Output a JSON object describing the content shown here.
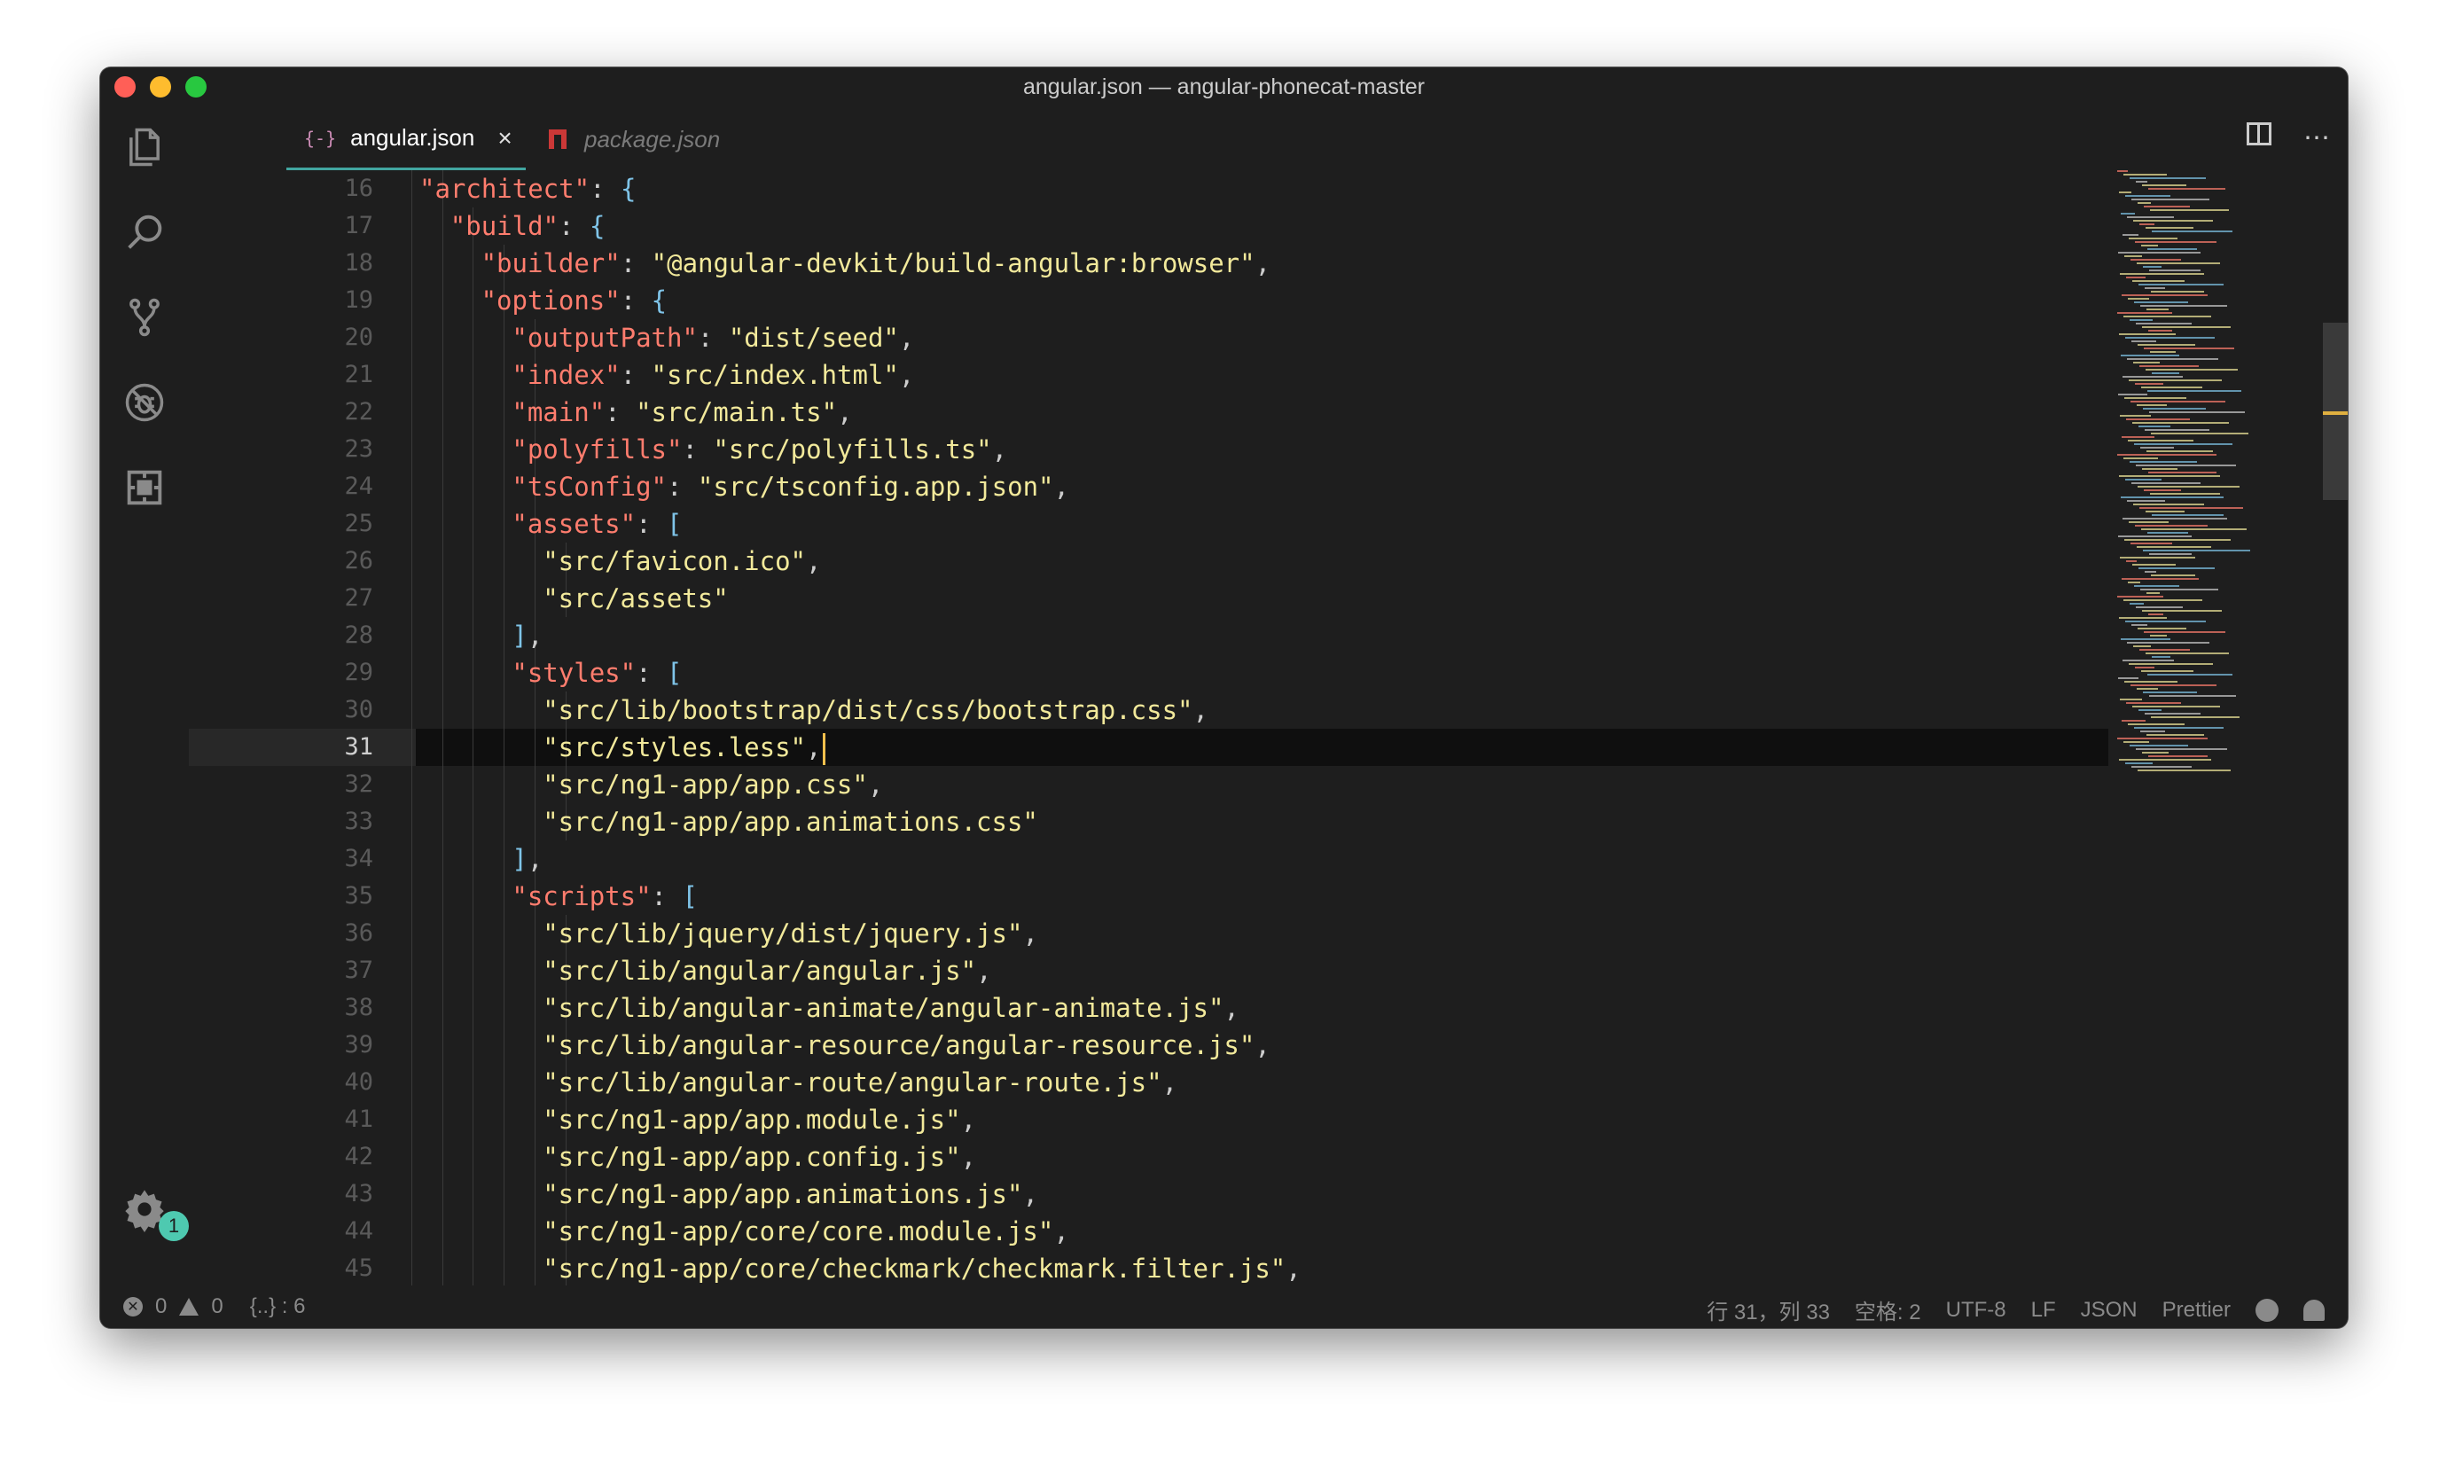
{
  "window": {
    "title": "angular.json — angular-phonecat-master"
  },
  "activity_bar": {
    "items": [
      {
        "name": "explorer-icon"
      },
      {
        "name": "search-icon"
      },
      {
        "name": "source-control-icon"
      },
      {
        "name": "debug-icon"
      },
      {
        "name": "extensions-icon"
      }
    ],
    "settings_badge": "1"
  },
  "tabs": [
    {
      "label": "angular.json",
      "icon": "{-}",
      "active": true,
      "close": "×"
    },
    {
      "label": "package.json",
      "active": false
    }
  ],
  "editor": {
    "lines": [
      {
        "n": "16",
        "indent": 3,
        "tokens": [
          [
            "k",
            "\"architect\""
          ],
          [
            "p",
            ": "
          ],
          [
            "b",
            "{"
          ]
        ]
      },
      {
        "n": "17",
        "indent": 4,
        "tokens": [
          [
            "k",
            "\"build\""
          ],
          [
            "p",
            ": "
          ],
          [
            "b",
            "{"
          ]
        ]
      },
      {
        "n": "18",
        "indent": 5,
        "tokens": [
          [
            "k",
            "\"builder\""
          ],
          [
            "p",
            ": "
          ],
          [
            "s",
            "\"@angular-devkit/build-angular:browser\""
          ],
          [
            "p",
            ","
          ]
        ]
      },
      {
        "n": "19",
        "indent": 5,
        "tokens": [
          [
            "k",
            "\"options\""
          ],
          [
            "p",
            ": "
          ],
          [
            "b",
            "{"
          ]
        ]
      },
      {
        "n": "20",
        "indent": 6,
        "tokens": [
          [
            "k",
            "\"outputPath\""
          ],
          [
            "p",
            ": "
          ],
          [
            "s",
            "\"dist/seed\""
          ],
          [
            "p",
            ","
          ]
        ]
      },
      {
        "n": "21",
        "indent": 6,
        "tokens": [
          [
            "k",
            "\"index\""
          ],
          [
            "p",
            ": "
          ],
          [
            "s",
            "\"src/index.html\""
          ],
          [
            "p",
            ","
          ]
        ]
      },
      {
        "n": "22",
        "indent": 6,
        "tokens": [
          [
            "k",
            "\"main\""
          ],
          [
            "p",
            ": "
          ],
          [
            "s",
            "\"src/main.ts\""
          ],
          [
            "p",
            ","
          ]
        ]
      },
      {
        "n": "23",
        "indent": 6,
        "tokens": [
          [
            "k",
            "\"polyfills\""
          ],
          [
            "p",
            ": "
          ],
          [
            "s",
            "\"src/polyfills.ts\""
          ],
          [
            "p",
            ","
          ]
        ]
      },
      {
        "n": "24",
        "indent": 6,
        "tokens": [
          [
            "k",
            "\"tsConfig\""
          ],
          [
            "p",
            ": "
          ],
          [
            "s",
            "\"src/tsconfig.app.json\""
          ],
          [
            "p",
            ","
          ]
        ]
      },
      {
        "n": "25",
        "indent": 6,
        "tokens": [
          [
            "k",
            "\"assets\""
          ],
          [
            "p",
            ": "
          ],
          [
            "b",
            "["
          ]
        ]
      },
      {
        "n": "26",
        "indent": 7,
        "tokens": [
          [
            "s",
            "\"src/favicon.ico\""
          ],
          [
            "p",
            ","
          ]
        ]
      },
      {
        "n": "27",
        "indent": 7,
        "tokens": [
          [
            "s",
            "\"src/assets\""
          ]
        ]
      },
      {
        "n": "28",
        "indent": 6,
        "tokens": [
          [
            "b",
            "]"
          ],
          [
            "p",
            ","
          ]
        ]
      },
      {
        "n": "29",
        "indent": 6,
        "tokens": [
          [
            "k",
            "\"styles\""
          ],
          [
            "p",
            ": "
          ],
          [
            "b",
            "["
          ]
        ]
      },
      {
        "n": "30",
        "indent": 7,
        "tokens": [
          [
            "s",
            "\"src/lib/bootstrap/dist/css/bootstrap.css\""
          ],
          [
            "p",
            ","
          ]
        ]
      },
      {
        "n": "31",
        "indent": 7,
        "current": true,
        "tokens": [
          [
            "s",
            "\"src/styles.less\""
          ],
          [
            "p",
            ","
          ]
        ]
      },
      {
        "n": "32",
        "indent": 7,
        "tokens": [
          [
            "s",
            "\"src/ng1-app/app.css\""
          ],
          [
            "p",
            ","
          ]
        ]
      },
      {
        "n": "33",
        "indent": 7,
        "tokens": [
          [
            "s",
            "\"src/ng1-app/app.animations.css\""
          ]
        ]
      },
      {
        "n": "34",
        "indent": 6,
        "tokens": [
          [
            "b",
            "]"
          ],
          [
            "p",
            ","
          ]
        ]
      },
      {
        "n": "35",
        "indent": 6,
        "tokens": [
          [
            "k",
            "\"scripts\""
          ],
          [
            "p",
            ": "
          ],
          [
            "b",
            "["
          ]
        ]
      },
      {
        "n": "36",
        "indent": 7,
        "tokens": [
          [
            "s",
            "\"src/lib/jquery/dist/jquery.js\""
          ],
          [
            "p",
            ","
          ]
        ]
      },
      {
        "n": "37",
        "indent": 7,
        "tokens": [
          [
            "s",
            "\"src/lib/angular/angular.js\""
          ],
          [
            "p",
            ","
          ]
        ]
      },
      {
        "n": "38",
        "indent": 7,
        "tokens": [
          [
            "s",
            "\"src/lib/angular-animate/angular-animate.js\""
          ],
          [
            "p",
            ","
          ]
        ]
      },
      {
        "n": "39",
        "indent": 7,
        "tokens": [
          [
            "s",
            "\"src/lib/angular-resource/angular-resource.js\""
          ],
          [
            "p",
            ","
          ]
        ]
      },
      {
        "n": "40",
        "indent": 7,
        "tokens": [
          [
            "s",
            "\"src/lib/angular-route/angular-route.js\""
          ],
          [
            "p",
            ","
          ]
        ]
      },
      {
        "n": "41",
        "indent": 7,
        "tokens": [
          [
            "s",
            "\"src/ng1-app/app.module.js\""
          ],
          [
            "p",
            ","
          ]
        ]
      },
      {
        "n": "42",
        "indent": 7,
        "tokens": [
          [
            "s",
            "\"src/ng1-app/app.config.js\""
          ],
          [
            "p",
            ","
          ]
        ]
      },
      {
        "n": "43",
        "indent": 7,
        "tokens": [
          [
            "s",
            "\"src/ng1-app/app.animations.js\""
          ],
          [
            "p",
            ","
          ]
        ]
      },
      {
        "n": "44",
        "indent": 7,
        "tokens": [
          [
            "s",
            "\"src/ng1-app/core/core.module.js\""
          ],
          [
            "p",
            ","
          ]
        ]
      },
      {
        "n": "45",
        "indent": 7,
        "tokens": [
          [
            "s",
            "\"src/ng1-app/core/checkmark/checkmark.filter.js\""
          ],
          [
            "p",
            ","
          ]
        ]
      }
    ]
  },
  "statusbar": {
    "errors": "0",
    "warnings": "0",
    "json_symbols": "{..} : 6",
    "position": "行 31，列 33",
    "spaces": "空格: 2",
    "encoding": "UTF-8",
    "eol": "LF",
    "language": "JSON",
    "formatter": "Prettier"
  },
  "colors": {
    "background": "#1e1e1e",
    "json_key": "#ff7d6e",
    "json_string": "#f2e99b",
    "bracket": "#7fc4e8",
    "accent": "#41a6a0",
    "cursor": "#f5c04c"
  }
}
